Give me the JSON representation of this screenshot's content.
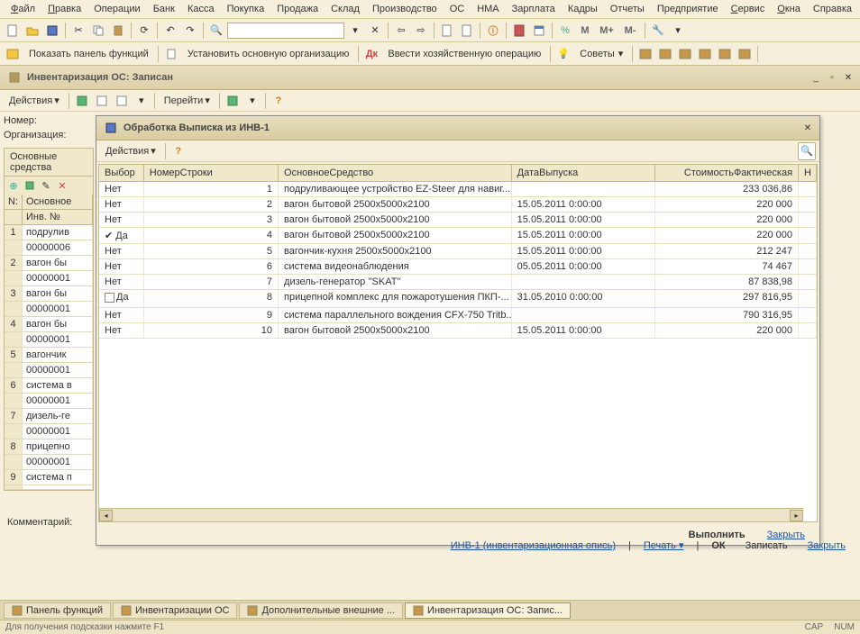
{
  "menu": [
    "Файл",
    "Правка",
    "Операции",
    "Банк",
    "Касса",
    "Покупка",
    "Продажа",
    "Склад",
    "Производство",
    "ОС",
    "НМА",
    "Зарплата",
    "Кадры",
    "Отчеты",
    "Предприятие",
    "Сервис",
    "Окна",
    "Справка"
  ],
  "toolbar_text": {
    "m": "M",
    "m_plus": "M+",
    "m_minus": "M-"
  },
  "toolbar2": {
    "show_panel": "Показать панель функций",
    "set_main_org": "Установить основную организацию",
    "enter_op": "Ввести хозяйственную операцию",
    "tips": "Советы"
  },
  "window": {
    "title": "Инвентаризация ОС: Записан",
    "actions_label": "Действия",
    "goto_label": "Перейти"
  },
  "left": {
    "label_number": "Номер:",
    "label_org": "Организация:",
    "tab_main": "Основные средства",
    "col_n": "N:",
    "col_main": "Основное",
    "col_inv": "Инв. №",
    "rows": [
      {
        "n": "1",
        "name": "подрулив",
        "inv": "00000006"
      },
      {
        "n": "2",
        "name": "вагон бы",
        "inv": "00000001"
      },
      {
        "n": "3",
        "name": "вагон бы",
        "inv": "00000001"
      },
      {
        "n": "4",
        "name": "вагон бы",
        "inv": "00000001"
      },
      {
        "n": "5",
        "name": "вагончик",
        "inv": "00000001"
      },
      {
        "n": "6",
        "name": "система в",
        "inv": "00000001"
      },
      {
        "n": "7",
        "name": "дизель-ге",
        "inv": "00000001"
      },
      {
        "n": "8",
        "name": "прицепно",
        "inv": "00000001"
      },
      {
        "n": "9",
        "name": "система п",
        "inv": ""
      }
    ]
  },
  "dialog": {
    "title": "Обработка  Выписка из ИНВ-1",
    "actions_label": "Действия",
    "columns": [
      "Выбор",
      "НомерСтроки",
      "ОсновноеСредство",
      "ДатаВыпуска",
      "СтоимостьФактическая",
      "Н"
    ],
    "rows": [
      {
        "sel": "Нет",
        "n": "1",
        "item": "подруливающее устройство EZ-Steer для навиг...",
        "date": "",
        "cost": "233 036,86"
      },
      {
        "sel": "Нет",
        "n": "2",
        "item": "вагон бытовой 2500x5000x2100",
        "date": "15.05.2011 0:00:00",
        "cost": "220 000"
      },
      {
        "sel": "Нет",
        "n": "3",
        "item": "вагон бытовой 2500x5000x2100",
        "date": "15.05.2011 0:00:00",
        "cost": "220 000"
      },
      {
        "sel": "Да",
        "check": true,
        "n": "4",
        "item": "вагон бытовой 2500x5000x2100",
        "date": "15.05.2011 0:00:00",
        "cost": "220 000"
      },
      {
        "sel": "Нет",
        "n": "5",
        "item": "вагончик-кухня 2500x5000x2100",
        "date": "15.05.2011 0:00:00",
        "cost": "212 247"
      },
      {
        "sel": "Нет",
        "n": "6",
        "item": "система видеонаблюдения",
        "date": "05.05.2011 0:00:00",
        "cost": "74 467"
      },
      {
        "sel": "Нет",
        "n": "7",
        "item": "дизель-генератор ''SKAT''",
        "date": "",
        "cost": "87 838,98"
      },
      {
        "sel": "Да",
        "checkbox": true,
        "n": "8",
        "item": "прицепной комплекс для пожаротушения ПКП-...",
        "date": "31.05.2010 0:00:00",
        "cost": "297 816,95"
      },
      {
        "sel": "Нет",
        "n": "9",
        "item": "система параллельного вождения CFX-750 Tritb...",
        "date": "",
        "cost": "790 316,95"
      },
      {
        "sel": "Нет",
        "n": "10",
        "item": "вагон бытовой 2500x5000x2100",
        "date": "15.05.2011 0:00:00",
        "cost": "220 000"
      }
    ],
    "execute": "Выполнить",
    "close": "Закрыть"
  },
  "comment_label": "Комментарий:",
  "bottom": {
    "inv1": "ИНВ-1 (инвентаризационная опись)",
    "print": "Печать",
    "ok": "ОК",
    "save": "Записать",
    "close": "Закрыть"
  },
  "taskbar": [
    {
      "label": "Панель функций",
      "active": false
    },
    {
      "label": "Инвентаризации ОС",
      "active": false
    },
    {
      "label": "Дополнительные внешние ...",
      "active": false
    },
    {
      "label": "Инвентаризация ОС: Запис...",
      "active": true
    }
  ],
  "statusbar": {
    "hint": "Для получения подсказки нажмите F1",
    "cap": "CAP",
    "num": "NUM"
  }
}
